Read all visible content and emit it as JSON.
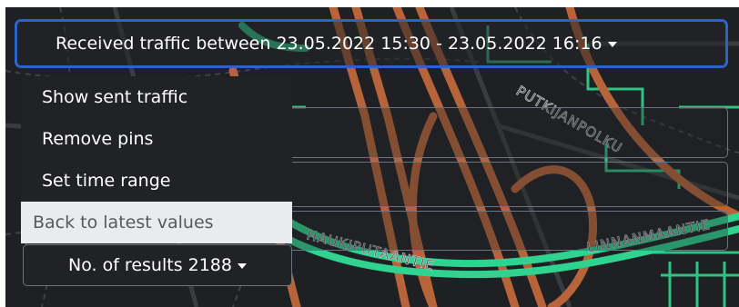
{
  "header": {
    "traffic_range_label": "Received traffic between 23.05.2022 15:30 - 23.05.2022 16:16"
  },
  "menu": {
    "items": [
      {
        "label": "Show sent traffic"
      },
      {
        "label": "Remove pins"
      },
      {
        "label": "Set time range"
      },
      {
        "label": "Back to latest values"
      }
    ]
  },
  "results": {
    "label": "No. of results 2188"
  },
  "map": {
    "street_labels": [
      "HAUKIPUTAANTIE",
      "LINNANMAANTIE",
      "PUTKIJANPOLKU"
    ]
  },
  "colors": {
    "map_background": "#1f2023",
    "road_primary": "#b8643a",
    "road_highway": "#2fd38f",
    "road_minor": "#3b3d41",
    "focus_border": "#2b63c9",
    "active_item_bg": "#e9ecef"
  },
  "icons": {
    "dropdown": "caret-down-icon"
  }
}
